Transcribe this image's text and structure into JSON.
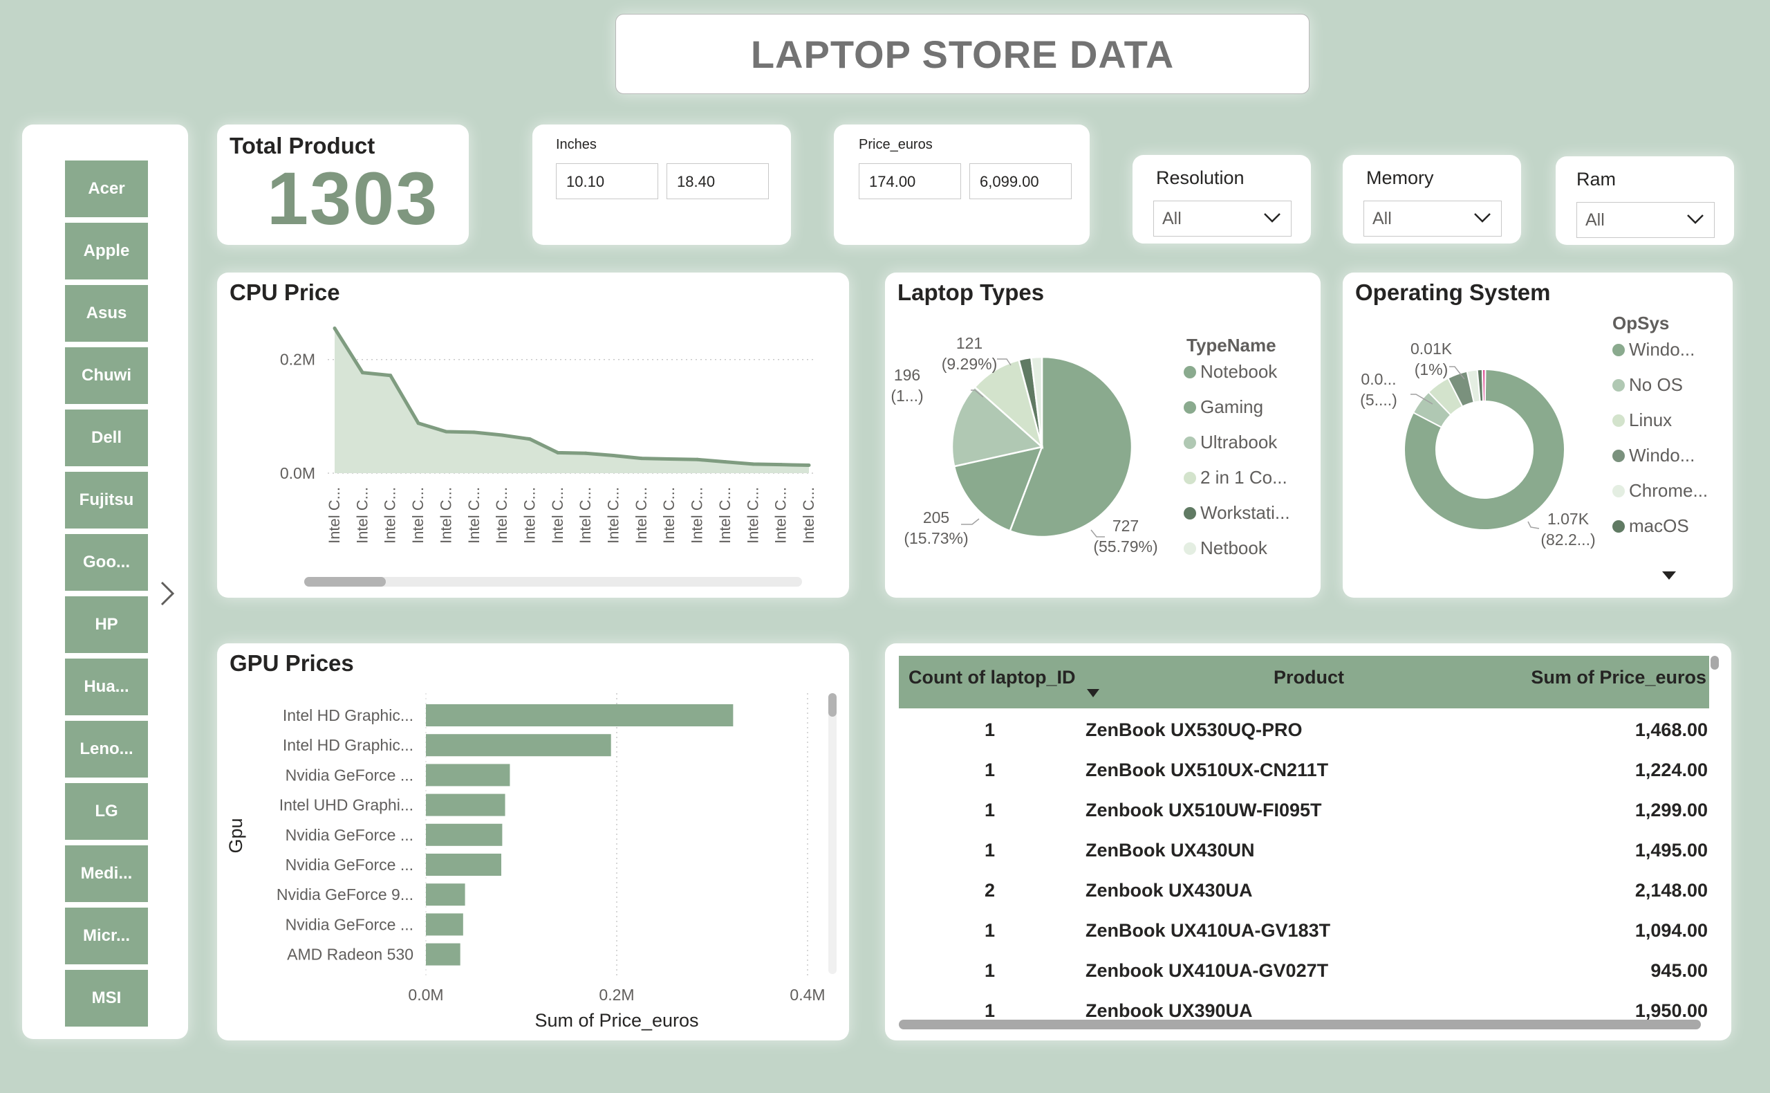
{
  "header": {
    "title": "LAPTOP STORE DATA"
  },
  "brand_slicer": {
    "items": [
      "Acer",
      "Apple",
      "Asus",
      "Chuwi",
      "Dell",
      "Fujitsu",
      "Goo...",
      "HP",
      "Hua...",
      "Leno...",
      "LG",
      "Medi...",
      "Micr...",
      "MSI"
    ]
  },
  "kpi": {
    "label": "Total Product",
    "value": "1303"
  },
  "inches_slicer": {
    "label": "Inches",
    "min": "10.10",
    "max": "18.40"
  },
  "price_slicer": {
    "label": "Price_euros",
    "min": "174.00",
    "max": "6,099.00"
  },
  "dropdowns": [
    {
      "label": "Resolution",
      "value": "All"
    },
    {
      "label": "Memory",
      "value": "All"
    },
    {
      "label": "Ram",
      "value": "All"
    }
  ],
  "cpu_chart": {
    "title": "CPU Price",
    "y_ticks": [
      "0.2M",
      "0.0M"
    ],
    "x_label": "Intel C..."
  },
  "laptop_types": {
    "title": "Laptop Types",
    "legend_title": "TypeName",
    "labels": [
      {
        "line1": "121",
        "line2": "(9.29%)"
      },
      {
        "line1": "196",
        "line2": "(1...)"
      },
      {
        "line1": "205",
        "line2": "(15.73%)"
      },
      {
        "line1": "727",
        "line2": "(55.79%)"
      }
    ]
  },
  "os_chart": {
    "title": "Operating System",
    "legend_title": "OpSys",
    "labels": [
      {
        "line1": "0.01K",
        "line2": "(1%)"
      },
      {
        "line1": "0.0...",
        "line2": "(5....)"
      },
      {
        "line1": "1.07K",
        "line2": "(82.2...)"
      }
    ]
  },
  "gpu_chart": {
    "title": "GPU Prices",
    "y_axis_label": "Gpu",
    "x_axis_label": "Sum of Price_euros",
    "x_ticks": [
      "0.0M",
      "0.2M",
      "0.4M"
    ]
  },
  "table": {
    "columns": [
      "Count of laptop_ID",
      "Product",
      "Sum of Price_euros"
    ],
    "rows": [
      {
        "count": "1",
        "product": "ZenBook UX530UQ-PRO",
        "price": "1,468.00"
      },
      {
        "count": "1",
        "product": "ZenBook UX510UX-CN211T",
        "price": "1,224.00"
      },
      {
        "count": "1",
        "product": "Zenbook UX510UW-FI095T",
        "price": "1,299.00"
      },
      {
        "count": "1",
        "product": "ZenBook UX430UN",
        "price": "1,495.00"
      },
      {
        "count": "2",
        "product": "Zenbook UX430UA",
        "price": "2,148.00"
      },
      {
        "count": "1",
        "product": "ZenBook UX410UA-GV183T",
        "price": "1,094.00"
      },
      {
        "count": "1",
        "product": "Zenbook UX410UA-GV027T",
        "price": "945.00"
      },
      {
        "count": "1",
        "product": "Zenbook UX390UA",
        "price": "1,950.00"
      }
    ]
  },
  "colors": {
    "background": "#c2d5c8",
    "accent": "#8aaa8e",
    "notebook": "#8aaa8e",
    "gaming": "#8aaa8e",
    "ultrabook": "#b0c8b3",
    "twoinone": "#d3e3cc",
    "workstation": "#607a63",
    "netbook": "#e4eee2",
    "os_pink": "#e0589a"
  },
  "chart_data": [
    {
      "type": "area",
      "title": "CPU Price",
      "categories": [
        "Intel C...",
        "Intel C...",
        "Intel C...",
        "Intel C...",
        "Intel C...",
        "Intel C...",
        "Intel C...",
        "Intel C...",
        "Intel C...",
        "Intel C...",
        "Intel C...",
        "Intel C...",
        "Intel C...",
        "Intel C...",
        "Intel C...",
        "Intel C...",
        "Intel C...",
        "Intel C..."
      ],
      "values": [
        0.255,
        0.177,
        0.172,
        0.088,
        0.073,
        0.072,
        0.067,
        0.06,
        0.036,
        0.035,
        0.031,
        0.026,
        0.025,
        0.024,
        0.02,
        0.016,
        0.015,
        0.014
      ],
      "unit": "M",
      "ylim": [
        0,
        0.28
      ],
      "y_ticks": [
        "0.0M",
        "0.2M"
      ]
    },
    {
      "type": "pie",
      "title": "Laptop Types",
      "legend_title": "TypeName",
      "slices": [
        {
          "name": "Notebook",
          "value": 727,
          "label": "727 (55.79%)",
          "color": "#8aaa8e"
        },
        {
          "name": "Gaming",
          "value": 205,
          "label": "205 (15.73%)",
          "color": "#8aaa8e"
        },
        {
          "name": "Ultrabook",
          "value": 196,
          "label": "196 (1...)",
          "color": "#b0c8b3"
        },
        {
          "name": "2 in 1 Co...",
          "value": 121,
          "label": "121 (9.29%)",
          "color": "#d3e3cc"
        },
        {
          "name": "Workstati...",
          "value": 29,
          "color": "#607a63"
        },
        {
          "name": "Netbook",
          "value": 25,
          "color": "#e4eee2"
        }
      ]
    },
    {
      "type": "pie",
      "subtype": "donut",
      "title": "Operating System",
      "legend_title": "OpSys",
      "slices": [
        {
          "name": "Windo...",
          "value": 1072,
          "label": "1.07K (82.2...)",
          "color": "#8aaa8e"
        },
        {
          "name": "No OS",
          "value": 66,
          "label": "0.0... (5....)",
          "color": "#b0c8b3"
        },
        {
          "name": "Linux",
          "value": 62,
          "color": "#d3e3cc"
        },
        {
          "name": "Windo...",
          "value": 52,
          "color": "#7a917d"
        },
        {
          "name": "Chrome...",
          "value": 27,
          "color": "#e4eee2"
        },
        {
          "name": "macOS",
          "value": 13,
          "label": "0.01K (1%)",
          "color": "#607a63"
        },
        {
          "name": "",
          "value": 8,
          "color": "#e0589a"
        }
      ]
    },
    {
      "type": "bar",
      "orientation": "horizontal",
      "title": "GPU Prices",
      "xlabel": "Sum of Price_euros",
      "ylabel": "Gpu",
      "categories": [
        "Intel HD Graphic...",
        "Intel HD Graphic...",
        "Nvidia GeForce ...",
        "Intel UHD Graphi...",
        "Nvidia GeForce ...",
        "Nvidia GeForce ...",
        "Nvidia GeForce 9...",
        "Nvidia GeForce ...",
        "AMD Radeon 530"
      ],
      "values": [
        0.322,
        0.194,
        0.088,
        0.083,
        0.08,
        0.079,
        0.041,
        0.039,
        0.036
      ],
      "unit": "M",
      "xlim": [
        0,
        0.4
      ],
      "x_ticks": [
        "0.0M",
        "0.2M",
        "0.4M"
      ]
    }
  ]
}
